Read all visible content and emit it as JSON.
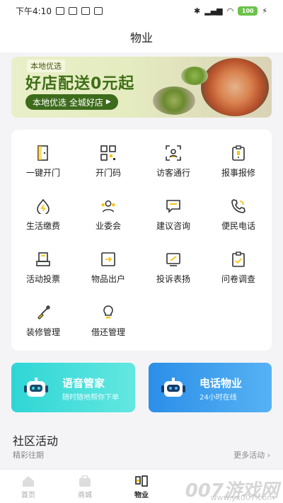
{
  "status_bar": {
    "time": "下午4:10",
    "battery": "100"
  },
  "nav": {
    "title": "物业"
  },
  "banner": {
    "tag": "本地优选",
    "title": "好店配送0元起",
    "button_label": "本地优选 全城好店"
  },
  "services": [
    {
      "label": "一键开门",
      "icon": "door-icon"
    },
    {
      "label": "开门码",
      "icon": "qr-code-icon"
    },
    {
      "label": "访客通行",
      "icon": "visitor-icon"
    },
    {
      "label": "报事报修",
      "icon": "repair-report-icon"
    },
    {
      "label": "生活缴费",
      "icon": "payment-icon"
    },
    {
      "label": "业委会",
      "icon": "committee-icon"
    },
    {
      "label": "建议咨询",
      "icon": "suggestion-icon"
    },
    {
      "label": "便民电话",
      "icon": "phone-icon"
    },
    {
      "label": "活动投票",
      "icon": "vote-icon"
    },
    {
      "label": "物品出户",
      "icon": "item-exit-icon"
    },
    {
      "label": "投诉表扬",
      "icon": "complaint-icon"
    },
    {
      "label": "问卷调查",
      "icon": "survey-icon"
    },
    {
      "label": "装修管理",
      "icon": "renovation-icon"
    },
    {
      "label": "借还管理",
      "icon": "lightbulb-icon"
    }
  ],
  "promos": {
    "voice": {
      "title": "语音管家",
      "subtitle": "随时随地帮你下单"
    },
    "phone": {
      "title": "电话物业",
      "subtitle": "24小时在线"
    }
  },
  "community": {
    "title": "社区活动",
    "subtitle": "精彩往期",
    "more": "更多活动 ›"
  },
  "tabs": [
    {
      "label": "首页",
      "icon": "home-icon"
    },
    {
      "label": "商城",
      "icon": "shop-icon"
    },
    {
      "label": "物业",
      "icon": "property-icon",
      "active": true
    }
  ],
  "watermark": {
    "text": "007游戏网",
    "url": "www.yx007.com"
  },
  "colors": {
    "accent": "#f5c518",
    "icon_stroke": "#333333",
    "voice_gradient": "#2fd6d6",
    "phone_gradient": "#2b8fe8"
  }
}
